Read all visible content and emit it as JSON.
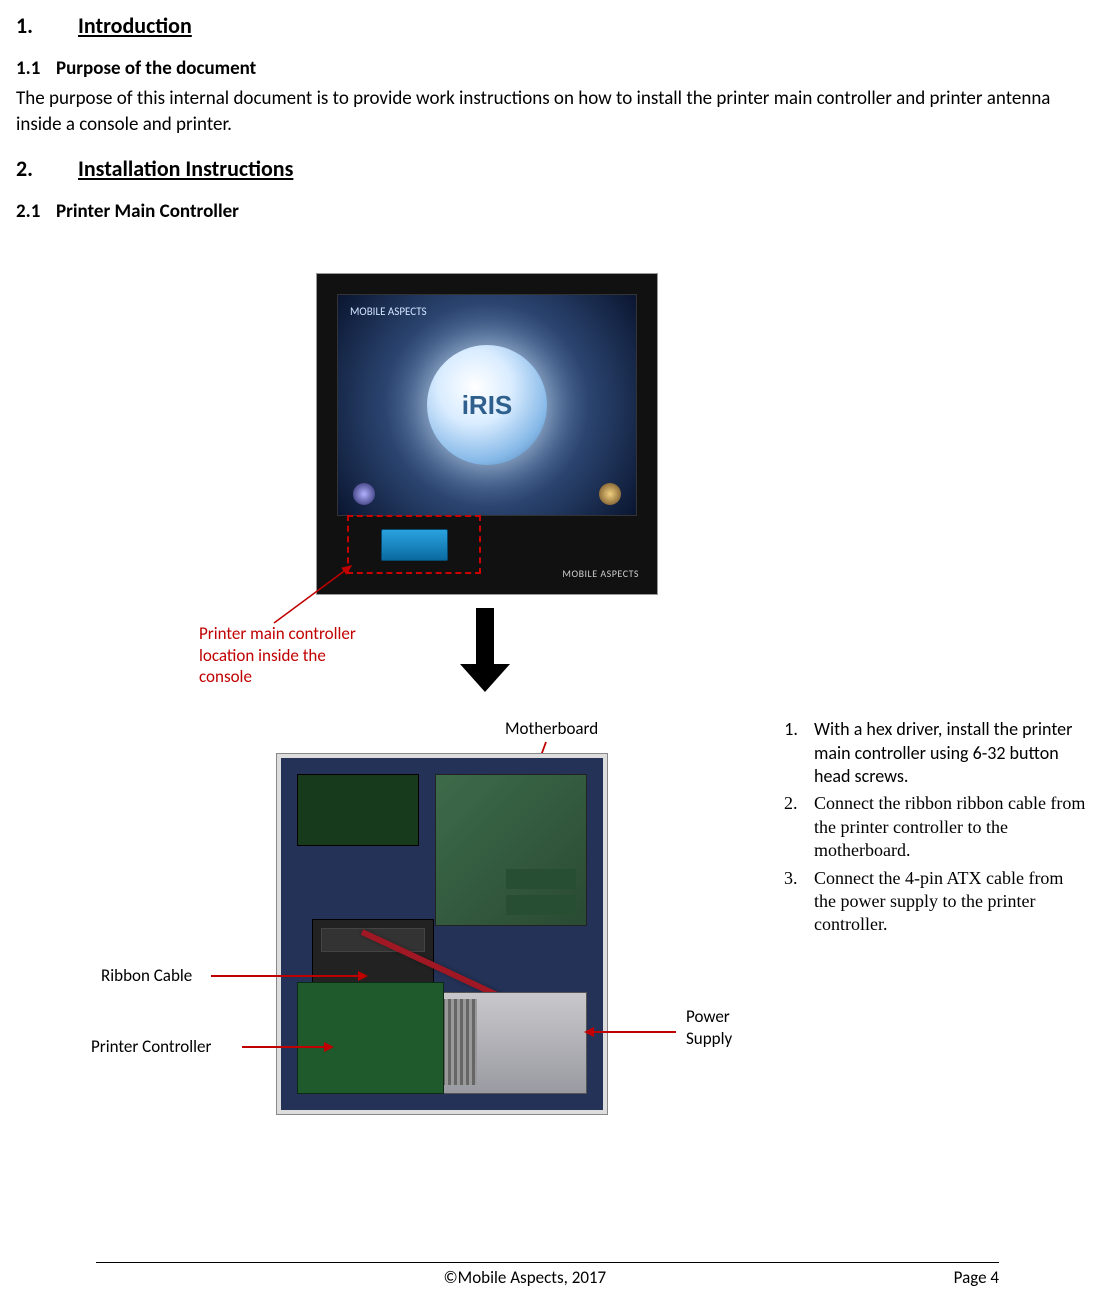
{
  "sections": {
    "s1": {
      "num": "1.",
      "title": "Introduction"
    },
    "s1_1": {
      "num": "1.1",
      "title": "Purpose of the document"
    },
    "s1_1_text": "The purpose of this internal document is to provide work instructions on how to install the printer main controller and printer antenna inside a console and printer.",
    "s2": {
      "num": "2.",
      "title": "Installation Instructions"
    },
    "s2_1": {
      "num": "2.1",
      "title": "Printer Main Controller"
    }
  },
  "figure": {
    "iris_label": "iRIS",
    "brand_small": "MOBILE ASPECTS",
    "callouts": {
      "printer_main_location": "Printer main controller location inside the console",
      "motherboard": "Motherboard",
      "ribbon_cable": "Ribbon Cable",
      "printer_controller": "Printer Controller",
      "power_supply": "Power Supply"
    }
  },
  "steps": [
    "With a hex driver, install the printer main controller using 6-32 button head screws.",
    "Connect the ribbon ribbon cable from the printer controller to the motherboard.",
    "Connect the 4-pin ATX cable from the power supply to the printer controller."
  ],
  "footer": {
    "copyright": "©Mobile Aspects, 2017",
    "page": "Page 4"
  }
}
